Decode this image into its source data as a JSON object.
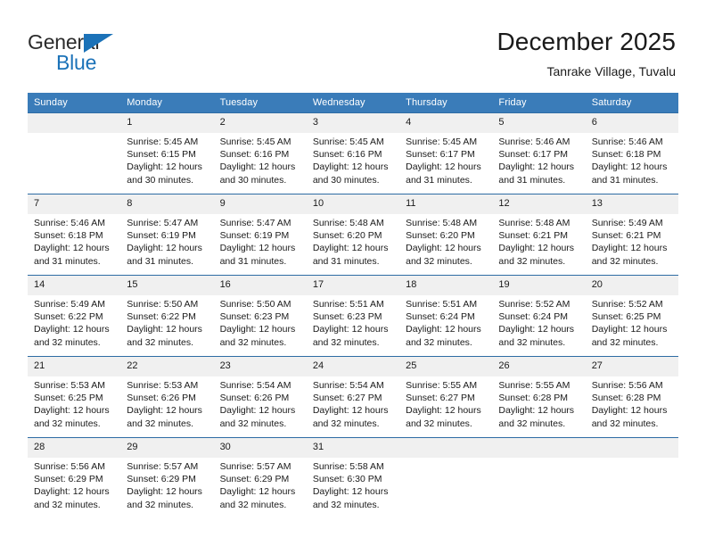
{
  "brand": {
    "name_top": "General",
    "name_bottom": "Blue",
    "triangle_color": "#1b72b8"
  },
  "header": {
    "title": "December 2025",
    "subtitle": "Tanrake Village, Tuvalu"
  },
  "theme": {
    "header_blue": "#3a7cb9",
    "row_divider_blue": "#2e6ca4",
    "daynum_gray": "#f0f0f0",
    "text": "#1a1a1a"
  },
  "weekday_headers": [
    "Sunday",
    "Monday",
    "Tuesday",
    "Wednesday",
    "Thursday",
    "Friday",
    "Saturday"
  ],
  "weeks": [
    [
      {
        "day": "",
        "line1": "",
        "line2": "",
        "line3": "",
        "line4": ""
      },
      {
        "day": "1",
        "line1": "Sunrise: 5:45 AM",
        "line2": "Sunset: 6:15 PM",
        "line3": "Daylight: 12 hours",
        "line4": "and 30 minutes."
      },
      {
        "day": "2",
        "line1": "Sunrise: 5:45 AM",
        "line2": "Sunset: 6:16 PM",
        "line3": "Daylight: 12 hours",
        "line4": "and 30 minutes."
      },
      {
        "day": "3",
        "line1": "Sunrise: 5:45 AM",
        "line2": "Sunset: 6:16 PM",
        "line3": "Daylight: 12 hours",
        "line4": "and 30 minutes."
      },
      {
        "day": "4",
        "line1": "Sunrise: 5:45 AM",
        "line2": "Sunset: 6:17 PM",
        "line3": "Daylight: 12 hours",
        "line4": "and 31 minutes."
      },
      {
        "day": "5",
        "line1": "Sunrise: 5:46 AM",
        "line2": "Sunset: 6:17 PM",
        "line3": "Daylight: 12 hours",
        "line4": "and 31 minutes."
      },
      {
        "day": "6",
        "line1": "Sunrise: 5:46 AM",
        "line2": "Sunset: 6:18 PM",
        "line3": "Daylight: 12 hours",
        "line4": "and 31 minutes."
      }
    ],
    [
      {
        "day": "7",
        "line1": "Sunrise: 5:46 AM",
        "line2": "Sunset: 6:18 PM",
        "line3": "Daylight: 12 hours",
        "line4": "and 31 minutes."
      },
      {
        "day": "8",
        "line1": "Sunrise: 5:47 AM",
        "line2": "Sunset: 6:19 PM",
        "line3": "Daylight: 12 hours",
        "line4": "and 31 minutes."
      },
      {
        "day": "9",
        "line1": "Sunrise: 5:47 AM",
        "line2": "Sunset: 6:19 PM",
        "line3": "Daylight: 12 hours",
        "line4": "and 31 minutes."
      },
      {
        "day": "10",
        "line1": "Sunrise: 5:48 AM",
        "line2": "Sunset: 6:20 PM",
        "line3": "Daylight: 12 hours",
        "line4": "and 31 minutes."
      },
      {
        "day": "11",
        "line1": "Sunrise: 5:48 AM",
        "line2": "Sunset: 6:20 PM",
        "line3": "Daylight: 12 hours",
        "line4": "and 32 minutes."
      },
      {
        "day": "12",
        "line1": "Sunrise: 5:48 AM",
        "line2": "Sunset: 6:21 PM",
        "line3": "Daylight: 12 hours",
        "line4": "and 32 minutes."
      },
      {
        "day": "13",
        "line1": "Sunrise: 5:49 AM",
        "line2": "Sunset: 6:21 PM",
        "line3": "Daylight: 12 hours",
        "line4": "and 32 minutes."
      }
    ],
    [
      {
        "day": "14",
        "line1": "Sunrise: 5:49 AM",
        "line2": "Sunset: 6:22 PM",
        "line3": "Daylight: 12 hours",
        "line4": "and 32 minutes."
      },
      {
        "day": "15",
        "line1": "Sunrise: 5:50 AM",
        "line2": "Sunset: 6:22 PM",
        "line3": "Daylight: 12 hours",
        "line4": "and 32 minutes."
      },
      {
        "day": "16",
        "line1": "Sunrise: 5:50 AM",
        "line2": "Sunset: 6:23 PM",
        "line3": "Daylight: 12 hours",
        "line4": "and 32 minutes."
      },
      {
        "day": "17",
        "line1": "Sunrise: 5:51 AM",
        "line2": "Sunset: 6:23 PM",
        "line3": "Daylight: 12 hours",
        "line4": "and 32 minutes."
      },
      {
        "day": "18",
        "line1": "Sunrise: 5:51 AM",
        "line2": "Sunset: 6:24 PM",
        "line3": "Daylight: 12 hours",
        "line4": "and 32 minutes."
      },
      {
        "day": "19",
        "line1": "Sunrise: 5:52 AM",
        "line2": "Sunset: 6:24 PM",
        "line3": "Daylight: 12 hours",
        "line4": "and 32 minutes."
      },
      {
        "day": "20",
        "line1": "Sunrise: 5:52 AM",
        "line2": "Sunset: 6:25 PM",
        "line3": "Daylight: 12 hours",
        "line4": "and 32 minutes."
      }
    ],
    [
      {
        "day": "21",
        "line1": "Sunrise: 5:53 AM",
        "line2": "Sunset: 6:25 PM",
        "line3": "Daylight: 12 hours",
        "line4": "and 32 minutes."
      },
      {
        "day": "22",
        "line1": "Sunrise: 5:53 AM",
        "line2": "Sunset: 6:26 PM",
        "line3": "Daylight: 12 hours",
        "line4": "and 32 minutes."
      },
      {
        "day": "23",
        "line1": "Sunrise: 5:54 AM",
        "line2": "Sunset: 6:26 PM",
        "line3": "Daylight: 12 hours",
        "line4": "and 32 minutes."
      },
      {
        "day": "24",
        "line1": "Sunrise: 5:54 AM",
        "line2": "Sunset: 6:27 PM",
        "line3": "Daylight: 12 hours",
        "line4": "and 32 minutes."
      },
      {
        "day": "25",
        "line1": "Sunrise: 5:55 AM",
        "line2": "Sunset: 6:27 PM",
        "line3": "Daylight: 12 hours",
        "line4": "and 32 minutes."
      },
      {
        "day": "26",
        "line1": "Sunrise: 5:55 AM",
        "line2": "Sunset: 6:28 PM",
        "line3": "Daylight: 12 hours",
        "line4": "and 32 minutes."
      },
      {
        "day": "27",
        "line1": "Sunrise: 5:56 AM",
        "line2": "Sunset: 6:28 PM",
        "line3": "Daylight: 12 hours",
        "line4": "and 32 minutes."
      }
    ],
    [
      {
        "day": "28",
        "line1": "Sunrise: 5:56 AM",
        "line2": "Sunset: 6:29 PM",
        "line3": "Daylight: 12 hours",
        "line4": "and 32 minutes."
      },
      {
        "day": "29",
        "line1": "Sunrise: 5:57 AM",
        "line2": "Sunset: 6:29 PM",
        "line3": "Daylight: 12 hours",
        "line4": "and 32 minutes."
      },
      {
        "day": "30",
        "line1": "Sunrise: 5:57 AM",
        "line2": "Sunset: 6:29 PM",
        "line3": "Daylight: 12 hours",
        "line4": "and 32 minutes."
      },
      {
        "day": "31",
        "line1": "Sunrise: 5:58 AM",
        "line2": "Sunset: 6:30 PM",
        "line3": "Daylight: 12 hours",
        "line4": "and 32 minutes."
      },
      {
        "day": "",
        "line1": "",
        "line2": "",
        "line3": "",
        "line4": ""
      },
      {
        "day": "",
        "line1": "",
        "line2": "",
        "line3": "",
        "line4": ""
      },
      {
        "day": "",
        "line1": "",
        "line2": "",
        "line3": "",
        "line4": ""
      }
    ]
  ]
}
